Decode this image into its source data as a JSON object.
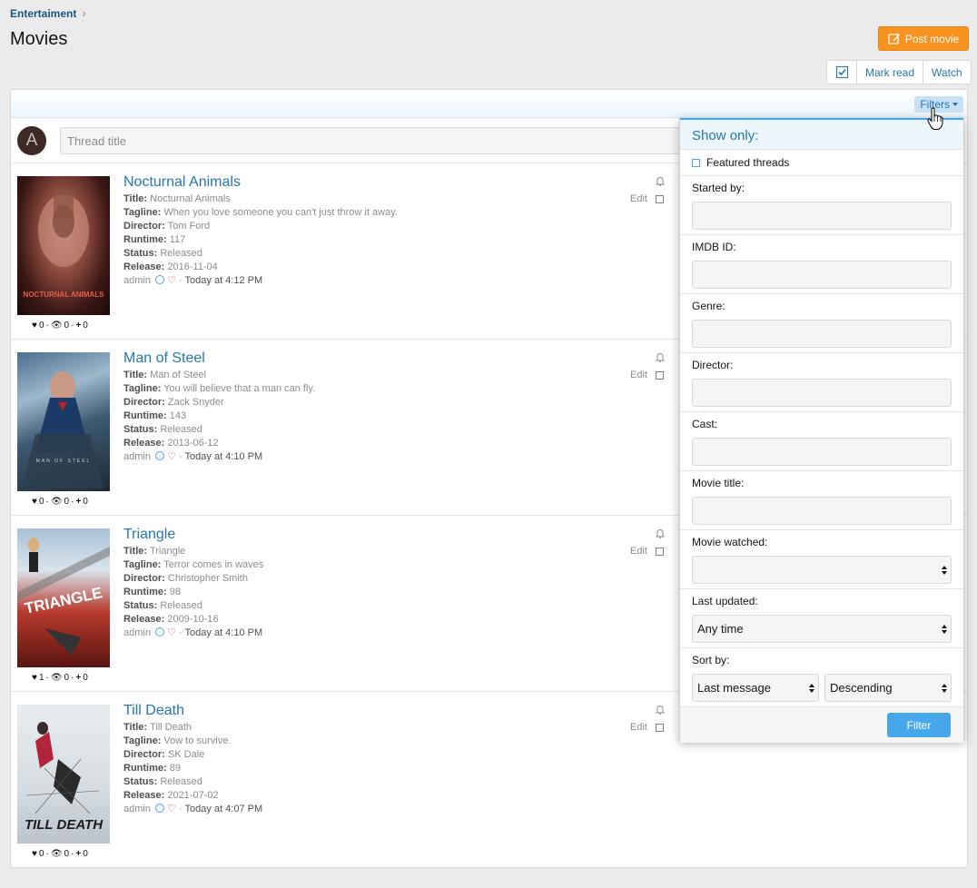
{
  "breadcrumb": {
    "label": "Entertaiment",
    "sep": "›"
  },
  "page": {
    "title": "Movies"
  },
  "post_button": {
    "label": "Post movie"
  },
  "actions": {
    "mark_read": "Mark read",
    "watch": "Watch"
  },
  "filter_bar": {
    "filters_label": "Filters"
  },
  "quick_thread": {
    "avatar_letter": "A",
    "placeholder": "Thread title"
  },
  "movies": [
    {
      "title": "Nocturnal Animals",
      "title_label": "Title:",
      "title_val": "Nocturnal Animals",
      "tagline_label": "Tagline:",
      "tagline": "When you love someone you can't just throw it away.",
      "director_label": "Director:",
      "director": "Tom Ford",
      "runtime_label": "Runtime:",
      "runtime": "117",
      "status_label": "Status:",
      "status": "Released",
      "release_label": "Release:",
      "release": "2016-11-04",
      "author": "admin",
      "date": "Today at 4:12 PM",
      "likes": "0",
      "views": "0",
      "plus": "0",
      "edit": "Edit",
      "poster_text": "NOCTURNAL ANIMALS"
    },
    {
      "title": "Man of Steel",
      "title_label": "Title:",
      "title_val": "Man of Steel",
      "tagline_label": "Tagline:",
      "tagline": "You will believe that a man can fly.",
      "director_label": "Director:",
      "director": "Zack Snyder",
      "runtime_label": "Runtime:",
      "runtime": "143",
      "status_label": "Status:",
      "status": "Released",
      "release_label": "Release:",
      "release": "2013-06-12",
      "author": "admin",
      "date": "Today at 4:10 PM",
      "likes": "0",
      "views": "0",
      "plus": "0",
      "edit": "Edit",
      "poster_text": "MAN OF STEEL"
    },
    {
      "title": "Triangle",
      "title_label": "Title:",
      "title_val": "Triangle",
      "tagline_label": "Tagline:",
      "tagline": "Terror comes in waves",
      "director_label": "Director:",
      "director": "Christopher Smith",
      "runtime_label": "Runtime:",
      "runtime": "98",
      "status_label": "Status:",
      "status": "Released",
      "release_label": "Release:",
      "release": "2009-10-16",
      "author": "admin",
      "date": "Today at 4:10 PM",
      "likes": "1",
      "views": "0",
      "plus": "0",
      "edit": "Edit",
      "poster_text": "TRIANGLE"
    },
    {
      "title": "Till Death",
      "title_label": "Title:",
      "title_val": "Till Death",
      "tagline_label": "Tagline:",
      "tagline": "Vow to survive.",
      "director_label": "Director:",
      "director": "SK Dale",
      "runtime_label": "Runtime:",
      "runtime": "89",
      "status_label": "Status:",
      "status": "Released",
      "release_label": "Release:",
      "release": "2021-07-02",
      "author": "admin",
      "date": "Today at 4:07 PM",
      "likes": "0",
      "views": "0",
      "plus": "0",
      "edit": "Edit",
      "poster_text": "TILL DEATH"
    }
  ],
  "filter_popup": {
    "heading": "Show only:",
    "featured": "Featured threads",
    "started_by": "Started by:",
    "imdb": "IMDB ID:",
    "genre": "Genre:",
    "director": "Director:",
    "cast": "Cast:",
    "movie_title": "Movie title:",
    "movie_watched": "Movie watched:",
    "last_updated": "Last updated:",
    "last_updated_value": "Any time",
    "sort_by": "Sort by:",
    "sort_field": "Last message",
    "sort_dir": "Descending",
    "submit": "Filter"
  },
  "colors": {
    "accent": "#2577b1",
    "post_button": "#f7931e",
    "filter_button": "#47a7eb"
  }
}
